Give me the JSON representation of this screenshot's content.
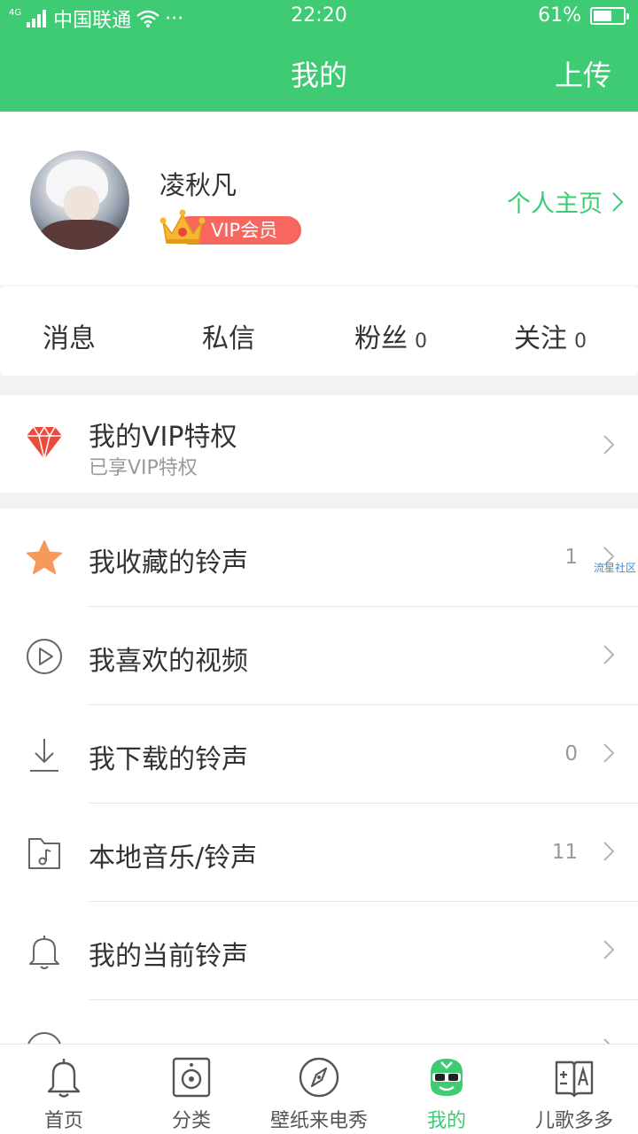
{
  "status_bar": {
    "network": "4G",
    "carrier": "中国联通",
    "dots": "···",
    "time": "22:20",
    "battery": "61%",
    "battery_level": 0.61
  },
  "header": {
    "title": "我的",
    "upload": "上传"
  },
  "profile": {
    "name": "凌秋凡",
    "vip_label": "VIP会员",
    "home_link": "个人主页"
  },
  "stats": [
    {
      "label": "消息",
      "count": ""
    },
    {
      "label": "私信",
      "count": ""
    },
    {
      "label": "粉丝",
      "count": "0"
    },
    {
      "label": "关注",
      "count": "0"
    }
  ],
  "vip_section": {
    "title": "我的VIP特权",
    "subtitle": "已享VIP特权"
  },
  "list": [
    {
      "label": "我收藏的铃声",
      "count": "1",
      "icon": "star-icon"
    },
    {
      "label": "我喜欢的视频",
      "count": "",
      "icon": "play-circle-icon"
    },
    {
      "label": "我下载的铃声",
      "count": "0",
      "icon": "download-icon"
    },
    {
      "label": "本地音乐/铃声",
      "count": "11",
      "icon": "music-folder-icon"
    },
    {
      "label": "我的当前铃声",
      "count": "",
      "icon": "bell-icon"
    },
    {
      "label": "",
      "count": "",
      "icon": "partial-icon"
    }
  ],
  "watermark": "流星社区",
  "bottom_nav": [
    {
      "label": "首页",
      "icon": "bell-icon",
      "active": false
    },
    {
      "label": "分类",
      "icon": "speaker-icon",
      "active": false
    },
    {
      "label": "壁纸来电秀",
      "icon": "compass-icon",
      "active": false
    },
    {
      "label": "我的",
      "icon": "mascot-icon",
      "active": true
    },
    {
      "label": "儿歌多多",
      "icon": "book-icon",
      "active": false
    }
  ],
  "colors": {
    "accent": "#3ecb74",
    "vip_pill": "#f7675f",
    "diamond": "#ec4a3a",
    "star": "#f59a5a"
  }
}
